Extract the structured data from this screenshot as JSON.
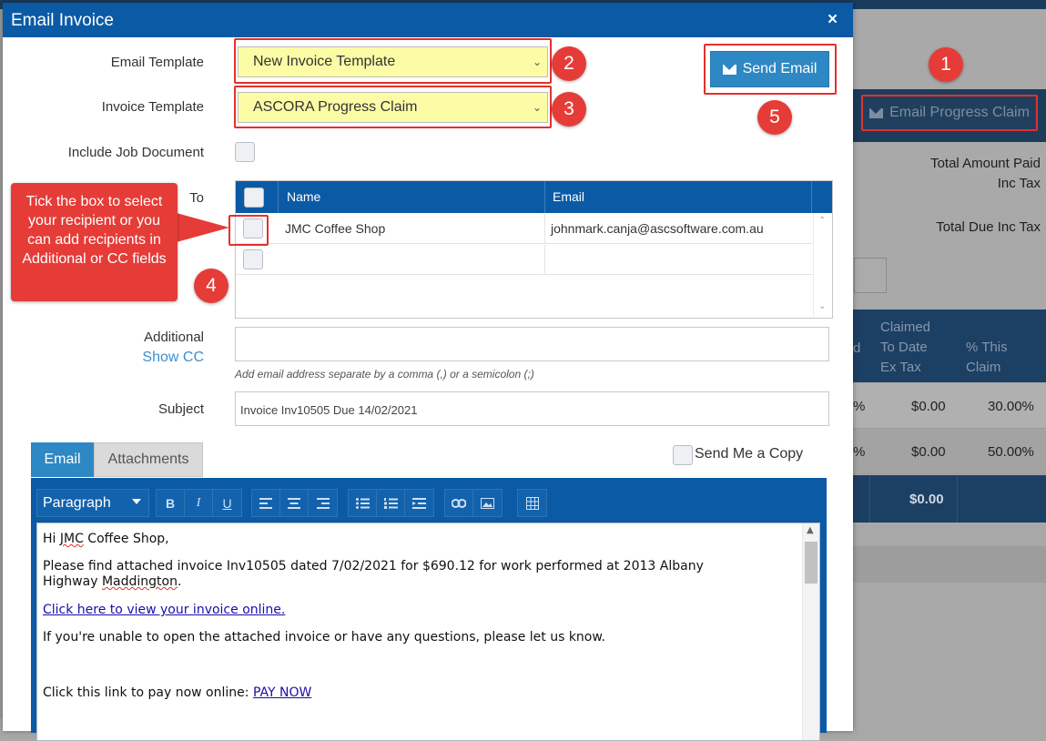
{
  "dialog": {
    "title": "Email Invoice",
    "close_glyph": "×"
  },
  "form": {
    "email_template_label": "Email Template",
    "email_template_value": "New Invoice Template",
    "invoice_template_label": "Invoice Template",
    "invoice_template_value": "ASCORA Progress Claim",
    "include_job_document_label": "Include Job Document",
    "to_label": "To",
    "additional_label": "Additional",
    "show_cc_link": "Show CC",
    "additional_hint": "Add email address separate by a comma (,) or a semicolon (;)",
    "subject_label": "Subject",
    "subject_value": "Invoice Inv10505 Due 14/02/2021",
    "send_email_label": "Send Email",
    "send_me_copy_label": "Send Me a Copy"
  },
  "recipients": {
    "columns": [
      "Name",
      "Email"
    ],
    "rows": [
      {
        "name": "JMC Coffee Shop",
        "email": "johnmark.canja@ascsoftware.com.au"
      },
      {
        "name": "",
        "email": ""
      }
    ]
  },
  "tabs": [
    {
      "label": "Email",
      "active": true
    },
    {
      "label": "Attachments",
      "active": false
    }
  ],
  "editor": {
    "format_select": "Paragraph",
    "toolbar": {
      "bold": "B",
      "italic": "I",
      "underline": "U"
    },
    "body": {
      "greeting_prefix": "Hi ",
      "greeting_name_word": "JMC",
      "greeting_suffix": " Coffee Shop,",
      "line1_a": "Please find attached invoice Inv10505 dated 7/02/2021 for $690.12 for work performed at 2013 Albany Highway ",
      "line1_misspelled": "Maddington",
      "line1_end": ".",
      "view_link": "Click here to view your invoice online.",
      "line2": "If you're unable to open the attached invoice or have any questions, please let us know.",
      "pay_prefix": "Click this link to pay now online: ",
      "pay_link": "PAY NOW"
    }
  },
  "annotations": {
    "badges": [
      "1",
      "2",
      "3",
      "4",
      "5"
    ],
    "callout": "Tick the box to select your recipient or you can add recipients in Additional or CC fields",
    "accent_color": "#e53c38"
  },
  "background_page": {
    "email_progress_claim": "Email Progress Claim",
    "total_amount_paid": "Total Amount Paid",
    "inc_tax": "Inc Tax",
    "total_due_inc_tax": "Total Due Inc Tax",
    "col_partial": "d",
    "col_claimed": "Claimed To Date Ex Tax",
    "col_claimed_lines": [
      "Claimed",
      "To Date",
      "Ex Tax"
    ],
    "col_pct_lines": [
      "% This",
      "Claim"
    ],
    "rows": [
      {
        "partial": "%",
        "claimed": "$0.00",
        "pct": "30.00%"
      },
      {
        "partial": "%",
        "claimed": "$0.00",
        "pct": "50.00%"
      }
    ],
    "total": "$0.00"
  },
  "colors": {
    "header_blue": "#0b5aa5",
    "button_blue": "#2e88c4",
    "select_yellow": "#fcfca6",
    "annotation_red": "#e53c38"
  }
}
